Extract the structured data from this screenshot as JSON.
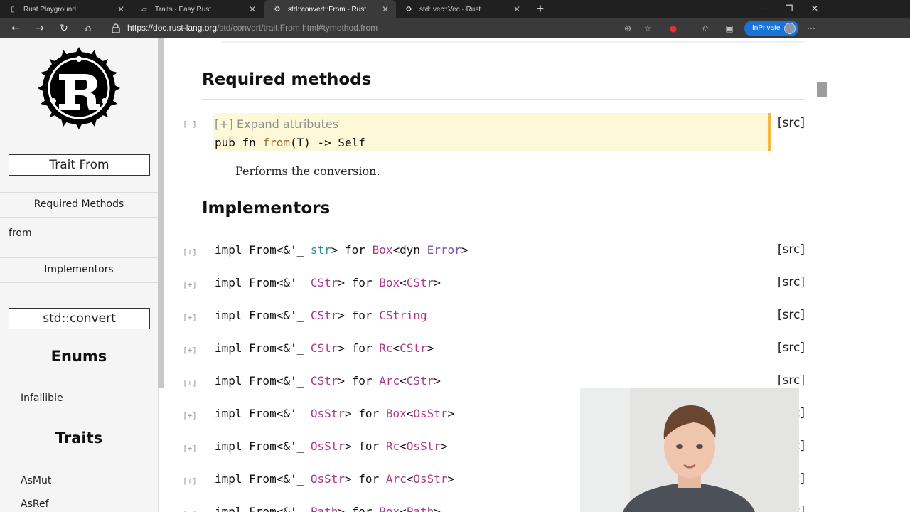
{
  "browser": {
    "tabs": [
      {
        "title": "Rust Playground",
        "close": "✕"
      },
      {
        "title": "Traits - Easy Rust",
        "close": "✕"
      },
      {
        "title": "std::convert::From - Rust",
        "close": "✕"
      },
      {
        "title": "std::vec::Vec - Rust",
        "close": "✕"
      }
    ],
    "new_tab": "+",
    "url_host": "https://doc.rust-lang.org",
    "url_path": "/std/convert/trait.From.html#tymethod.from",
    "inprivate_label": "InPrivate",
    "accent": "#1a73d9"
  },
  "sidebar": {
    "trait_title": "Trait From",
    "required_methods": "Required Methods",
    "method_from": "from",
    "implementors": "Implementors",
    "module": "std::convert",
    "enums_heading": "Enums",
    "enum_infallible": "Infallible",
    "traits_heading": "Traits",
    "trait_asmut": "AsMut",
    "trait_asref": "AsRef"
  },
  "main": {
    "required_methods_heading": "Required methods",
    "toggle_open": "[−]",
    "toggle_closed": "[+]",
    "src_label": "[src]",
    "expand_attributes": "[+] Expand attributes",
    "method_signature": {
      "pub_fn": "pub fn ",
      "name": "from",
      "rest": "(T) -> Self"
    },
    "method_doc": "Performs the conversion.",
    "implementors_heading": "Implementors",
    "impls": [
      {
        "a": "impl From<&'_ ",
        "b": "str",
        "bclass": "prim",
        "c": "> for ",
        "d": "Box",
        "e": "<dyn ",
        "f": "Error",
        "g": ">"
      },
      {
        "a": "impl From<&'_ ",
        "b": "CStr",
        "bclass": "ty",
        "c": "> for ",
        "d": "Box",
        "e": "<",
        "f": "CStr",
        "fclass": "ty",
        "g": ">"
      },
      {
        "a": "impl From<&'_ ",
        "b": "CStr",
        "bclass": "ty",
        "c": "> for ",
        "d": "CString",
        "e": "",
        "f": "",
        "g": ""
      },
      {
        "a": "impl From<&'_ ",
        "b": "CStr",
        "bclass": "ty",
        "c": "> for ",
        "d": "Rc",
        "e": "<",
        "f": "CStr",
        "fclass": "ty",
        "g": ">"
      },
      {
        "a": "impl From<&'_ ",
        "b": "CStr",
        "bclass": "ty",
        "c": "> for ",
        "d": "Arc",
        "e": "<",
        "f": "CStr",
        "fclass": "ty",
        "g": ">"
      },
      {
        "a": "impl From<&'_ ",
        "b": "OsStr",
        "bclass": "ty",
        "c": "> for ",
        "d": "Box",
        "e": "<",
        "f": "OsStr",
        "fclass": "ty",
        "g": ">"
      },
      {
        "a": "impl From<&'_ ",
        "b": "OsStr",
        "bclass": "ty",
        "c": "> for ",
        "d": "Rc",
        "e": "<",
        "f": "OsStr",
        "fclass": "ty",
        "g": ">"
      },
      {
        "a": "impl From<&'_ ",
        "b": "OsStr",
        "bclass": "ty",
        "c": "> for ",
        "d": "Arc",
        "e": "<",
        "f": "OsStr",
        "fclass": "ty",
        "g": ">"
      },
      {
        "a": "impl From<&'_ ",
        "b": "Path",
        "bclass": "ty",
        "c": "> for ",
        "d": "Box",
        "e": "<",
        "f": "Path",
        "fclass": "ty",
        "g": ">"
      }
    ]
  },
  "colors": {
    "type_color": "#ad378a",
    "primitive_color": "#2f8d94",
    "trait_color": "#7c5aaf",
    "fn_color": "#9a6e31",
    "method_highlight": "#fdf9d8"
  }
}
